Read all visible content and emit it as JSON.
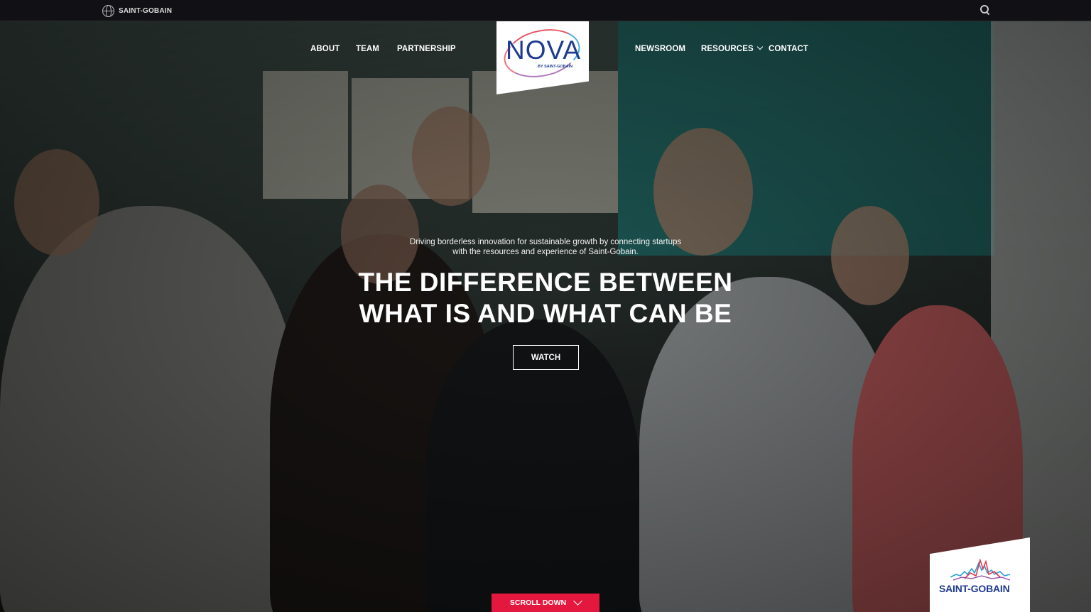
{
  "topbar": {
    "brand_label": "SAINT-GOBAIN",
    "brand_icon": "globe-icon",
    "search_icon": "search-icon"
  },
  "nav": {
    "left": [
      "ABOUT",
      "TEAM",
      "PARTNERSHIP"
    ],
    "right": [
      "NEWSROOM",
      "RESOURCES",
      "CONTACT"
    ]
  },
  "logo": {
    "word": "NOVA",
    "sub": "BY SAINT-GOBAIN"
  },
  "hero": {
    "tagline": "Driving borderless innovation for sustainable growth by connecting startups with the resources and experience of Saint-Gobain.",
    "headline_line1": "THE DIFFERENCE BETWEEN",
    "headline_line2": "WHAT IS AND WHAT CAN BE",
    "watch_label": "WATCH"
  },
  "scroll": {
    "label": "SCROLL DOWN"
  },
  "footer_badge": {
    "label": "SAINT-GOBAIN"
  },
  "colors": {
    "accent_red": "#e4173f",
    "brand_blue": "#1e3b8f",
    "topbar_bg": "#111014"
  }
}
